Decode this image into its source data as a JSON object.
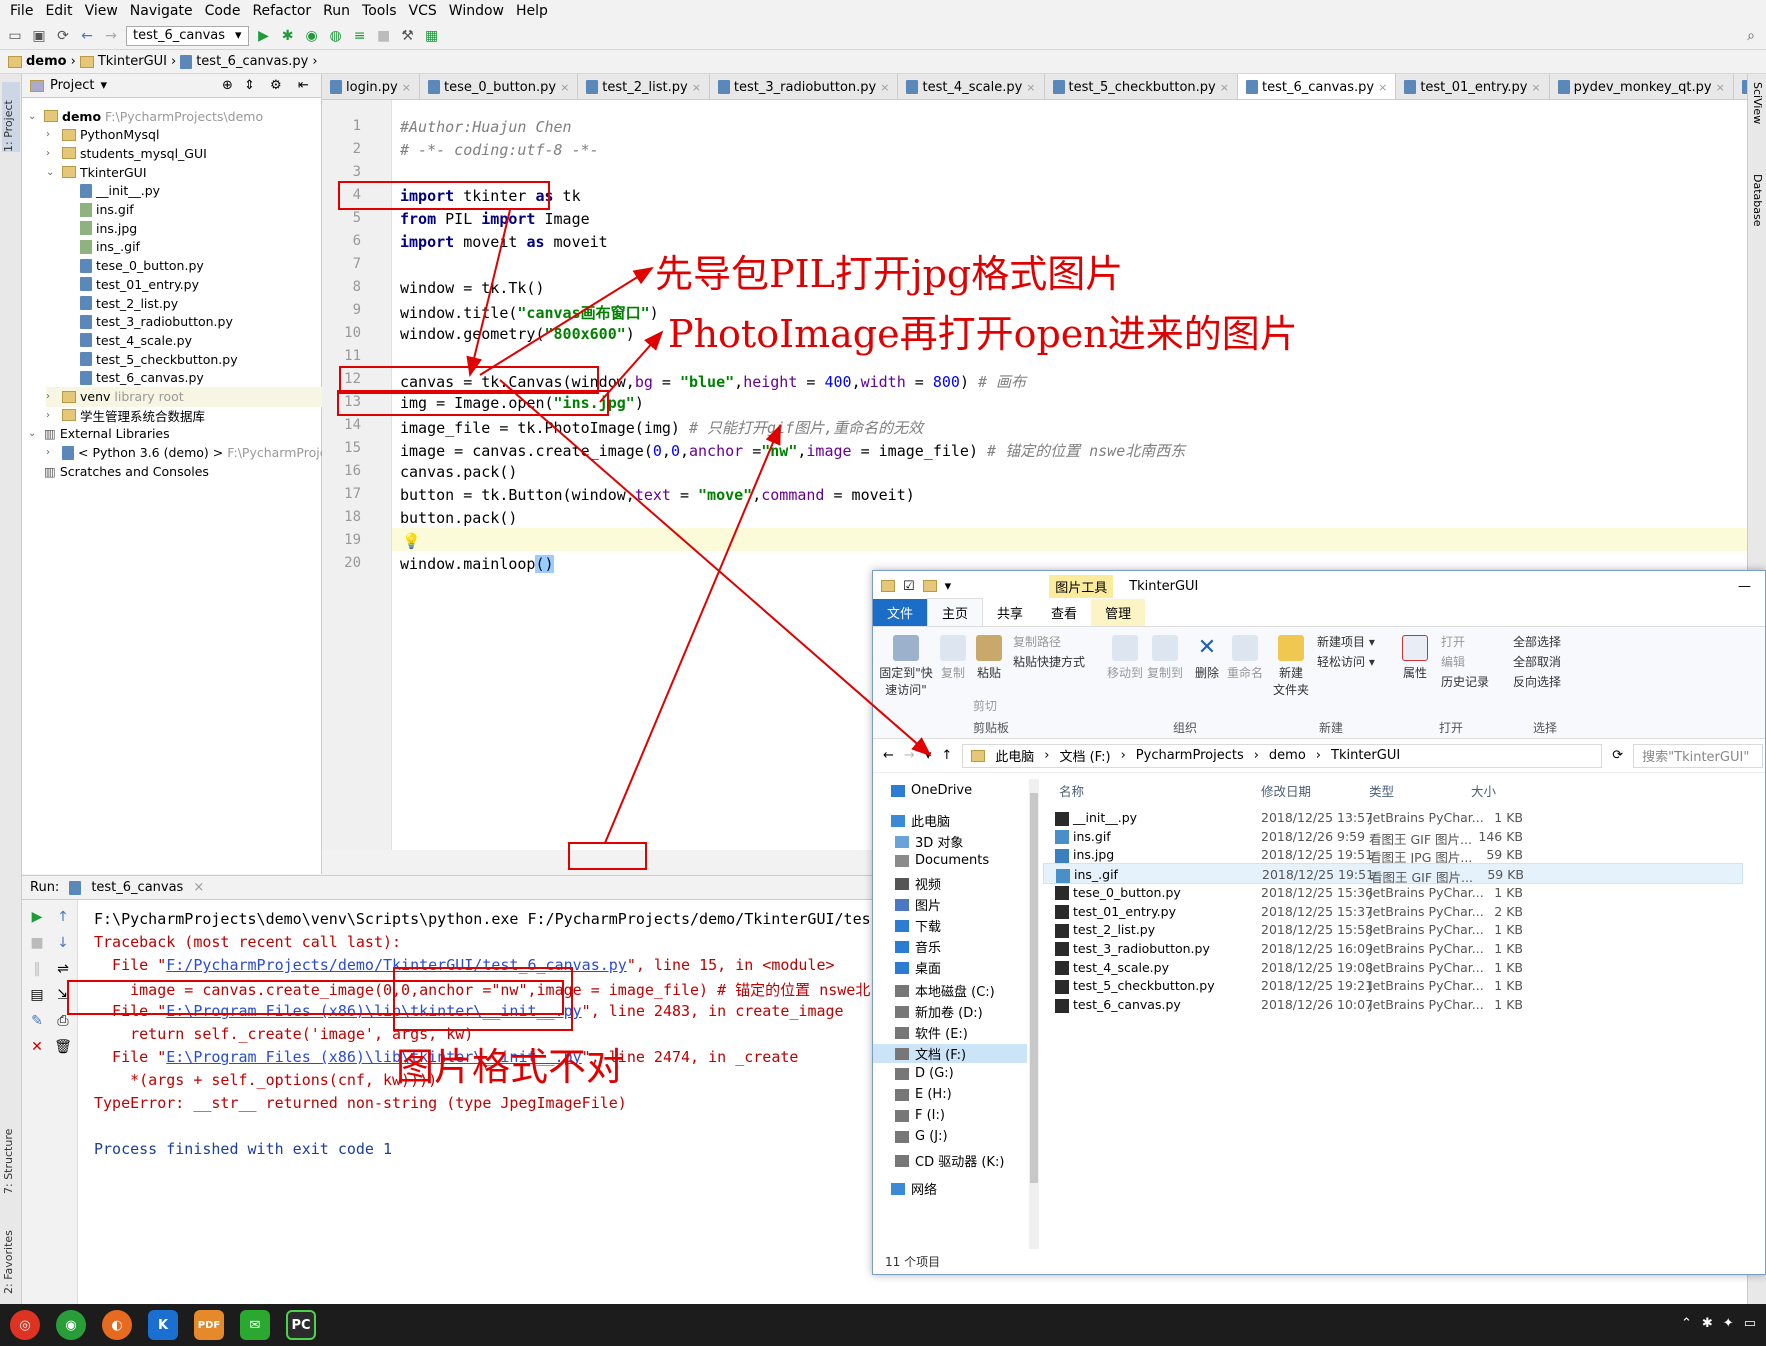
{
  "menu": [
    "File",
    "Edit",
    "View",
    "Navigate",
    "Code",
    "Refactor",
    "Run",
    "Tools",
    "VCS",
    "Window",
    "Help"
  ],
  "toolbar": {
    "run_config": "test_6_canvas"
  },
  "breadcrumb": [
    "demo",
    "TkinterGUI",
    "test_6_canvas.py"
  ],
  "side_tabs": {
    "project": "1: Project",
    "structure": "7: Structure",
    "favorites": "2: Favorites",
    "sciview": "SciView",
    "database": "Database"
  },
  "project": {
    "header": "Project",
    "tree": [
      {
        "label": "demo",
        "extra": "F:\\PycharmProjects\\demo",
        "type": "folder"
      },
      {
        "label": "PythonMysql",
        "type": "folder"
      },
      {
        "label": "students_mysql_GUI",
        "type": "folder"
      },
      {
        "label": "TkinterGUI",
        "type": "folder"
      },
      {
        "label": "__init__.py",
        "type": "py"
      },
      {
        "label": "ins.gif",
        "type": "img"
      },
      {
        "label": "ins.jpg",
        "type": "img"
      },
      {
        "label": "ins_.gif",
        "type": "img"
      },
      {
        "label": "tese_0_button.py",
        "type": "py"
      },
      {
        "label": "test_01_entry.py",
        "type": "py"
      },
      {
        "label": "test_2_list.py",
        "type": "py"
      },
      {
        "label": "test_3_radiobutton.py",
        "type": "py"
      },
      {
        "label": "test_4_scale.py",
        "type": "py"
      },
      {
        "label": "test_5_checkbutton.py",
        "type": "py"
      },
      {
        "label": "test_6_canvas.py",
        "type": "py"
      },
      {
        "label": "venv",
        "extra": "library root",
        "type": "folder"
      },
      {
        "label": "学生管理系统合数据库",
        "type": "folder"
      },
      {
        "label": "External Libraries",
        "type": "lib"
      },
      {
        "label": "< Python 3.6 (demo) >",
        "extra": "F:\\PycharmProject",
        "type": "py"
      },
      {
        "label": "Scratches and Consoles",
        "type": "lib"
      }
    ]
  },
  "tabs": [
    "login.py",
    "tese_0_button.py",
    "test_2_list.py",
    "test_3_radiobutton.py",
    "test_4_scale.py",
    "test_5_checkbutton.py",
    "test_6_canvas.py",
    "test_01_entry.py",
    "pydev_monkey_qt.py",
    "__init__.py"
  ],
  "run": {
    "label": "Run:",
    "config": "test_6_canvas",
    "output": [
      "F:\\PycharmProjects\\demo\\venv\\Scripts\\python.exe F:/PycharmProjects/demo/TkinterGUI/tes",
      "Traceback (most recent call last):",
      "  File \"F:/PycharmProjects/demo/TkinterGUI/test_6_canvas.py\", line 15, in <module>",
      "    image = canvas.create_image(0,0,anchor =\"nw\",image = image_file) # 锚定的位置 nswe北",
      "  File \"E:\\Program Files (x86)\\lib\\tkinter\\__init__.py\", line 2483, in create_image",
      "    return self._create('image', args, kw)",
      "  File \"E:\\Program Files (x86)\\lib\\tkinter\\__init__.py\", line 2474, in _create",
      "    *(args + self._options(cnf, kw))))",
      "TypeError: __str__ returned non-string (type JpegImageFile)",
      "",
      "Process finished with exit code 1"
    ]
  },
  "annotations": {
    "a1": "先导包PIL打开jpg格式图片",
    "a2": "PhotoImage再打开open进来的图片",
    "a3": "图片格式不对"
  },
  "explorer": {
    "title": "TkinterGUI",
    "tool_tab": "图片工具",
    "ribbon_tabs": [
      "文件",
      "主页",
      "共享",
      "查看",
      "管理"
    ],
    "ribbon": {
      "pin": "固定到\"快速访问\"",
      "copy": "复制",
      "paste": "粘贴",
      "copy_path": "复制路径",
      "paste_shortcut": "粘贴快捷方式",
      "cut": "剪切",
      "move_to": "移动到",
      "copy_to": "复制到",
      "delete": "删除",
      "rename": "重命名",
      "new_folder": "新建\n文件夹",
      "new_item": "新建项目",
      "easy_access": "轻松访问",
      "properties": "属性",
      "open": "打开",
      "edit": "编辑",
      "history": "历史记录",
      "select_all": "全部选择",
      "select_none": "全部取消",
      "invert": "反向选择",
      "g1": "剪贴板",
      "g2": "组织",
      "g3": "新建",
      "g4": "打开",
      "g5": "选择"
    },
    "address": [
      "此电脑",
      "文档 (F:)",
      "PycharmProjects",
      "demo",
      "TkinterGUI"
    ],
    "search_placeholder": "搜索\"TkinterGUI\"",
    "nav": [
      "OneDrive",
      "此电脑",
      "3D 对象",
      "Documents",
      "视频",
      "图片",
      "下载",
      "音乐",
      "桌面",
      "本地磁盘 (C:)",
      "新加卷 (D:)",
      "软件 (E:)",
      "文档 (F:)",
      "D (G:)",
      "E (H:)",
      "F (I:)",
      "G (J:)",
      "CD 驱动器 (K:)",
      "网络"
    ],
    "columns": [
      "名称",
      "修改日期",
      "类型",
      "大小"
    ],
    "files": [
      {
        "name": "__init__.py",
        "date": "2018/12/25 13:57",
        "type": "JetBrains PyChar...",
        "size": "1 KB",
        "kind": "py"
      },
      {
        "name": "ins.gif",
        "date": "2018/12/26 9:59",
        "type": "看图王 GIF 图片...",
        "size": "146 KB",
        "kind": "gif"
      },
      {
        "name": "ins.jpg",
        "date": "2018/12/25 19:51",
        "type": "看图王 JPG 图片...",
        "size": "59 KB",
        "kind": "jpg"
      },
      {
        "name": "ins_.gif",
        "date": "2018/12/25 19:51",
        "type": "看图王 GIF 图片...",
        "size": "59 KB",
        "kind": "gif"
      },
      {
        "name": "tese_0_button.py",
        "date": "2018/12/25 15:36",
        "type": "JetBrains PyChar...",
        "size": "1 KB",
        "kind": "py"
      },
      {
        "name": "test_01_entry.py",
        "date": "2018/12/25 15:37",
        "type": "JetBrains PyChar...",
        "size": "2 KB",
        "kind": "py"
      },
      {
        "name": "test_2_list.py",
        "date": "2018/12/25 15:58",
        "type": "JetBrains PyChar...",
        "size": "1 KB",
        "kind": "py"
      },
      {
        "name": "test_3_radiobutton.py",
        "date": "2018/12/25 16:09",
        "type": "JetBrains PyChar...",
        "size": "1 KB",
        "kind": "py"
      },
      {
        "name": "test_4_scale.py",
        "date": "2018/12/25 19:08",
        "type": "JetBrains PyChar...",
        "size": "1 KB",
        "kind": "py"
      },
      {
        "name": "test_5_checkbutton.py",
        "date": "2018/12/25 19:21",
        "type": "JetBrains PyChar...",
        "size": "1 KB",
        "kind": "py"
      },
      {
        "name": "test_6_canvas.py",
        "date": "2018/12/26 10:07",
        "type": "JetBrains PyChar...",
        "size": "1 KB",
        "kind": "py"
      }
    ],
    "status": "11 个项目"
  }
}
